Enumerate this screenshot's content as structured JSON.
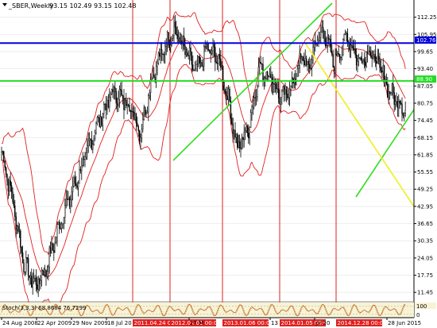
{
  "header": {
    "symbol": "_SBER,Weekly",
    "ohlc": "93.15 102.49 93.15 102.48"
  },
  "colors": {
    "background": "#ffffff",
    "candles": "#000000",
    "bollinger": "#e02020",
    "blue_level": "#0000dd",
    "green_level": "#22dd22",
    "green_trend": "#33dd22",
    "yellow_trend": "#eeee22",
    "vline": "#e02020",
    "vtag_bg": "#e02020",
    "stoch_bg": "#f7f3d4",
    "stoch_line_a": "#bb7700",
    "stoch_line_b": "#c03030"
  },
  "chart_data": {
    "type": "candlestick",
    "price_axis_ticks": [
      "112.25",
      "105.95",
      "99.65",
      "93.40",
      "87.05",
      "80.75",
      "74.45",
      "68.15",
      "61.85",
      "55.55",
      "49.25",
      "42.95",
      "36.65",
      "30.35",
      "24.05",
      "17.75",
      "11.45"
    ],
    "ylim": [
      8.3,
      118.55
    ],
    "horizontal_levels": [
      {
        "name": "blue",
        "value": 102.76,
        "label": "102.76"
      },
      {
        "name": "green",
        "value": 88.9,
        "label": "88.90"
      }
    ],
    "x_axis_labels": [
      "24 Aug 2008",
      "22 Apr 2009",
      "29 Nov 2009",
      "18 Jul 20",
      "27 M",
      "13",
      "pr 20",
      "28 Jun 2015"
    ],
    "vertical_marker_labels": [
      "2011.04.24 00:00",
      "2012.01.01 00:00",
      "2013.01.06 00:00",
      "2014.01.05 00:00",
      "2014.12.28 00:00"
    ],
    "series_shape": {
      "bars": 364,
      "anchors": [
        [
          0,
          63
        ],
        [
          10,
          45
        ],
        [
          20,
          22
        ],
        [
          30,
          14
        ],
        [
          40,
          20
        ],
        [
          55,
          40
        ],
        [
          70,
          55
        ],
        [
          85,
          72
        ],
        [
          100,
          85
        ],
        [
          115,
          80
        ],
        [
          125,
          70
        ],
        [
          135,
          90
        ],
        [
          145,
          100
        ],
        [
          155,
          108
        ],
        [
          165,
          100
        ],
        [
          175,
          92
        ],
        [
          185,
          101
        ],
        [
          195,
          97
        ],
        [
          205,
          80
        ],
        [
          212,
          64
        ],
        [
          222,
          72
        ],
        [
          232,
          94
        ],
        [
          242,
          90
        ],
        [
          252,
          82
        ],
        [
          262,
          88
        ],
        [
          270,
          98
        ],
        [
          276,
          93
        ],
        [
          282,
          103
        ],
        [
          290,
          107
        ],
        [
          298,
          96
        ],
        [
          305,
          100
        ],
        [
          311,
          106
        ],
        [
          316,
          100
        ],
        [
          322,
          96
        ],
        [
          330,
          100
        ],
        [
          340,
          94
        ],
        [
          350,
          84
        ],
        [
          360,
          80
        ],
        [
          370,
          74
        ],
        [
          380,
          66
        ],
        [
          390,
          72
        ],
        [
          395,
          78
        ],
        [
          405,
          76
        ],
        [
          412,
          68
        ],
        [
          420,
          70
        ],
        [
          430,
          68
        ],
        [
          440,
          62
        ],
        [
          445,
          55
        ],
        [
          452,
          56
        ],
        [
          458,
          66
        ],
        [
          466,
          70
        ],
        [
          474,
          68
        ],
        [
          484,
          72
        ],
        [
          492,
          74
        ],
        [
          500,
          74
        ],
        [
          505,
          82
        ],
        [
          510,
          91
        ],
        [
          514,
          96
        ]
      ]
    },
    "stochastic": {
      "label": "Stoch(3,3,3) 68.8684 76.7299",
      "levels": [
        20,
        80
      ]
    }
  },
  "price_tags": {
    "blue": "102.76",
    "green": "88.90",
    "stoch_top": "100",
    "stoch_bottom": "0"
  }
}
